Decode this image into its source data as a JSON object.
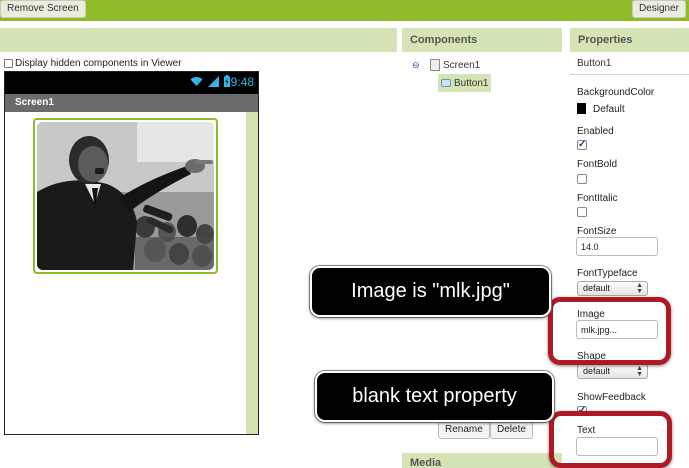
{
  "topbar": {
    "remove_screen_label": "Remove Screen",
    "designer_label": "Designer"
  },
  "viewer": {
    "display_hidden_label": "Display hidden components in Viewer",
    "clock": "9:48",
    "screen_title": "Screen1",
    "image_button": {
      "image_alt": "Portrait photo of a man speaking and gesturing in front of a crowd"
    }
  },
  "components": {
    "header": "Components",
    "tree": {
      "toggle": "⊖",
      "screen": "Screen1",
      "button": "Button1"
    },
    "rename_label": "Rename",
    "delete_label": "Delete",
    "media_header": "Media"
  },
  "properties": {
    "header": "Properties",
    "selected": "Button1",
    "background_color": {
      "label": "BackgroundColor",
      "value": "Default",
      "swatch": "#000000"
    },
    "enabled": {
      "label": "Enabled",
      "checked": true
    },
    "font_bold": {
      "label": "FontBold",
      "checked": false
    },
    "font_italic": {
      "label": "FontItalic",
      "checked": false
    },
    "font_size": {
      "label": "FontSize",
      "value": "14.0"
    },
    "font_typeface": {
      "label": "FontTypeface",
      "value": "default"
    },
    "image": {
      "label": "Image",
      "value": "mlk.jpg..."
    },
    "shape": {
      "label": "Shape",
      "value": "default"
    },
    "show_feedback": {
      "label": "ShowFeedback",
      "checked": true
    },
    "text": {
      "label": "Text",
      "value": ""
    }
  },
  "callouts": {
    "image_note": "Image is \"mlk.jpg\"",
    "text_note": "blank text property"
  },
  "colors": {
    "accent": "#8fbb2a",
    "panel_header": "#d5e4b5",
    "highlight": "#b01822",
    "clock": "#33b5e5"
  }
}
